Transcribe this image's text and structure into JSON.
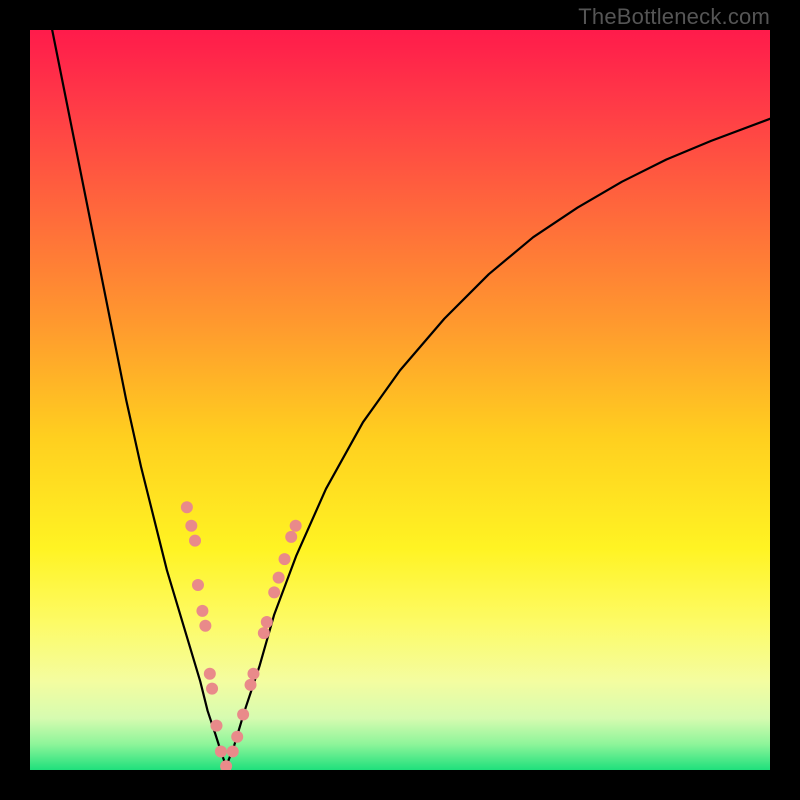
{
  "watermark": "TheBottleneck.com",
  "chart_data": {
    "type": "line",
    "title": "",
    "xlabel": "",
    "ylabel": "",
    "xlim": [
      0,
      100
    ],
    "ylim": [
      0,
      100
    ],
    "grid": false,
    "legend": false,
    "gradient_stops": [
      {
        "pos": 0.0,
        "color": "#ff1b4b"
      },
      {
        "pos": 0.1,
        "color": "#ff3a47"
      },
      {
        "pos": 0.25,
        "color": "#ff6a3b"
      },
      {
        "pos": 0.4,
        "color": "#ff9a2e"
      },
      {
        "pos": 0.55,
        "color": "#ffcf1f"
      },
      {
        "pos": 0.7,
        "color": "#fff323"
      },
      {
        "pos": 0.8,
        "color": "#fdfb65"
      },
      {
        "pos": 0.88,
        "color": "#f4fda0"
      },
      {
        "pos": 0.93,
        "color": "#d6fbb0"
      },
      {
        "pos": 0.965,
        "color": "#8ef59a"
      },
      {
        "pos": 1.0,
        "color": "#1fe07c"
      }
    ],
    "series": [
      {
        "name": "left-branch",
        "x": [
          3,
          5,
          7,
          9,
          11,
          13,
          15,
          17,
          18.5,
          20,
          21.5,
          23,
          24,
          25,
          25.8,
          26.5
        ],
        "y": [
          100,
          90,
          80,
          70,
          60,
          50,
          41,
          33,
          27,
          22,
          17,
          12,
          8,
          5,
          2.5,
          0.5
        ]
      },
      {
        "name": "right-branch",
        "x": [
          26.5,
          27.5,
          29,
          31,
          33,
          36,
          40,
          45,
          50,
          56,
          62,
          68,
          74,
          80,
          86,
          92,
          100
        ],
        "y": [
          0.5,
          3,
          8,
          14,
          21,
          29,
          38,
          47,
          54,
          61,
          67,
          72,
          76,
          79.5,
          82.5,
          85,
          88
        ]
      }
    ],
    "scatter": {
      "name": "highlight-dots",
      "color": "#e98a8a",
      "radius": 6,
      "points": [
        {
          "x": 21.2,
          "y": 35.5
        },
        {
          "x": 21.8,
          "y": 33.0
        },
        {
          "x": 22.3,
          "y": 31.0
        },
        {
          "x": 22.7,
          "y": 25.0
        },
        {
          "x": 23.3,
          "y": 21.5
        },
        {
          "x": 23.7,
          "y": 19.5
        },
        {
          "x": 24.3,
          "y": 13.0
        },
        {
          "x": 24.6,
          "y": 11.0
        },
        {
          "x": 25.2,
          "y": 6.0
        },
        {
          "x": 25.8,
          "y": 2.5
        },
        {
          "x": 26.5,
          "y": 0.5
        },
        {
          "x": 27.4,
          "y": 2.5
        },
        {
          "x": 28.0,
          "y": 4.5
        },
        {
          "x": 28.8,
          "y": 7.5
        },
        {
          "x": 29.8,
          "y": 11.5
        },
        {
          "x": 30.2,
          "y": 13.0
        },
        {
          "x": 31.6,
          "y": 18.5
        },
        {
          "x": 32.0,
          "y": 20.0
        },
        {
          "x": 33.0,
          "y": 24.0
        },
        {
          "x": 33.6,
          "y": 26.0
        },
        {
          "x": 34.4,
          "y": 28.5
        },
        {
          "x": 35.3,
          "y": 31.5
        },
        {
          "x": 35.9,
          "y": 33.0
        }
      ]
    },
    "notch": {
      "x": 26.5
    }
  }
}
